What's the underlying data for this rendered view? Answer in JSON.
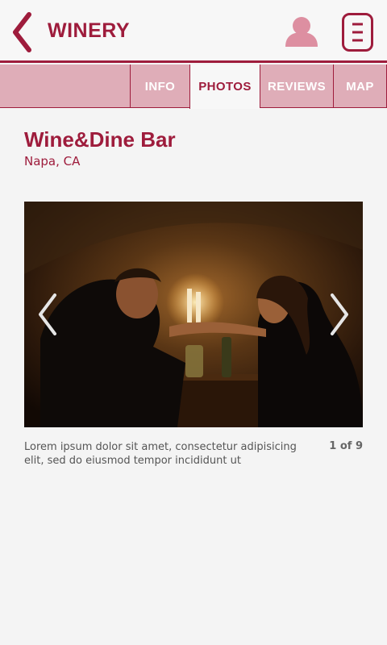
{
  "header": {
    "title": "WINERY",
    "back_icon": "chevron-left-icon",
    "user_icon": "user-icon",
    "menu_icon": "menu-icon",
    "accent_color": "#9e1c3c"
  },
  "tabs": [
    {
      "label": "INFO",
      "active": false
    },
    {
      "label": "PHOTOS",
      "active": true
    },
    {
      "label": "REVIEWS",
      "active": false
    },
    {
      "label": "MAP",
      "active": false
    }
  ],
  "venue": {
    "name": "Wine&Dine Bar",
    "location": "Napa, CA"
  },
  "gallery": {
    "caption": "Lorem ipsum dolor sit amet, consectetur adipisicing elit, sed do eiusmod tempor incididunt ut",
    "counter": "1 of 9",
    "current": 1,
    "total": 9
  }
}
